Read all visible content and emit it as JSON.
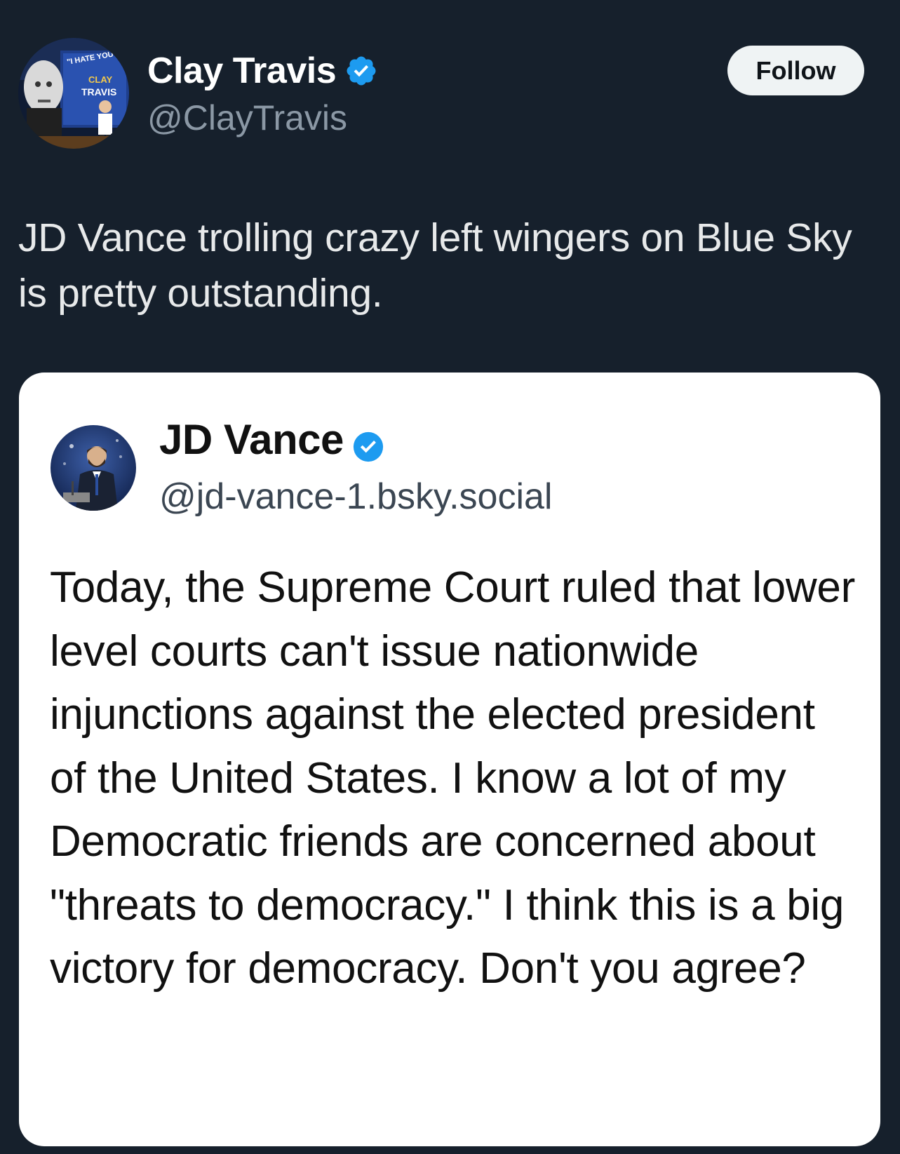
{
  "tweet": {
    "author": {
      "name": "Clay Travis",
      "handle": "@ClayTravis",
      "verified": true,
      "avatar_sign_text": "\"I HATE YOU CLAY TRAVIS\""
    },
    "follow_label": "Follow",
    "text": "JD Vance trolling crazy left wingers on Blue Sky is pretty outstanding."
  },
  "quote": {
    "author": {
      "name": "JD Vance",
      "handle": "@jd-vance-1.bsky.social",
      "verified": true
    },
    "text": "Today, the Supreme Court ruled that lower level courts can't issue nationwide injunctions against the elected president of the United States. I know a lot of my Democratic friends are concerned about \"threats to democracy.\" I think this is a big victory for democracy. Don't you agree?"
  },
  "colors": {
    "background": "#16202c",
    "verified_badge": "#1d9bf0",
    "follow_button_bg": "#eff3f4",
    "handle_gray": "#8b98a5"
  },
  "icons": {
    "verified": "verified-badge-icon"
  }
}
